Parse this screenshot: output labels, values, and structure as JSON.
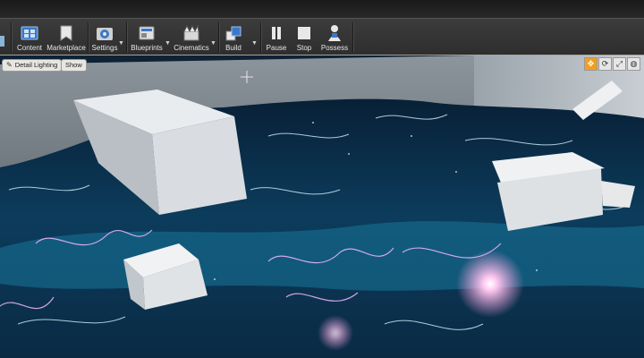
{
  "toolbar": {
    "items": [
      {
        "label": "",
        "icon": "partial-left-icon"
      },
      {
        "label": "Content",
        "icon": "content-browser-icon"
      },
      {
        "label": "Marketplace",
        "icon": "marketplace-icon"
      },
      {
        "label": "Settings",
        "icon": "settings-icon"
      },
      {
        "label": "Blueprints",
        "icon": "blueprints-icon"
      },
      {
        "label": "Cinematics",
        "icon": "cinematics-icon"
      },
      {
        "label": "Build",
        "icon": "build-icon"
      },
      {
        "label": "Pause",
        "icon": "pause-icon"
      },
      {
        "label": "Stop",
        "icon": "stop-icon"
      },
      {
        "label": "Possess",
        "icon": "possess-icon"
      }
    ]
  },
  "viewport": {
    "view_mode_label": "Detail Lighting",
    "show_label": "Show",
    "tools": [
      "move-icon",
      "rotate-icon",
      "scale-icon",
      "world-local-icon"
    ]
  },
  "colors": {
    "toolbar_bg": "#333333",
    "toolbar_accent": "#a9a39a",
    "active_tool": "#f0a020",
    "water": "#0e3a5a"
  }
}
